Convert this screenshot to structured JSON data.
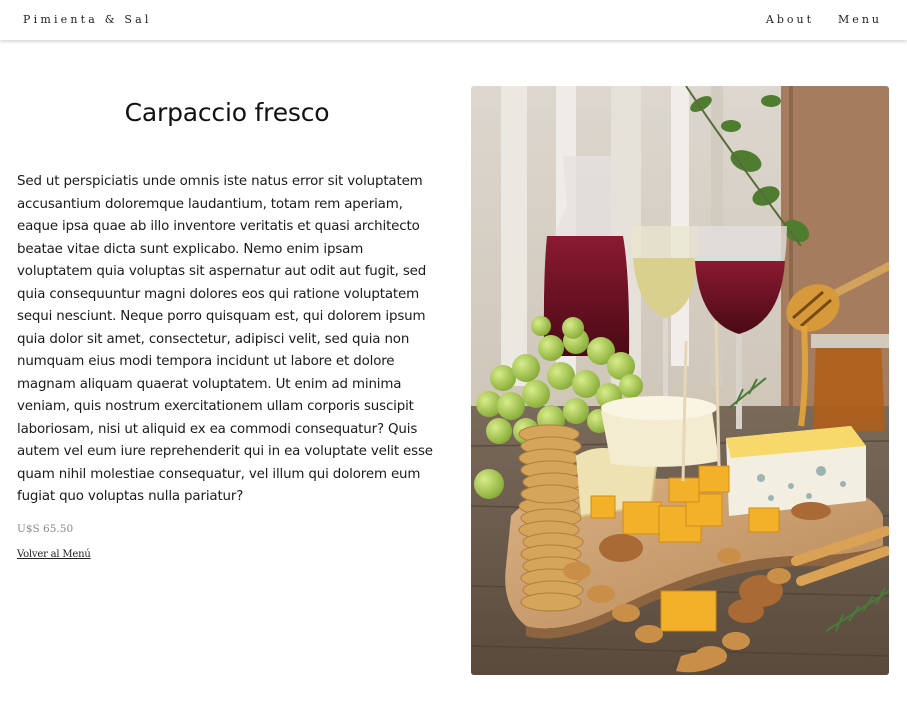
{
  "nav": {
    "brand": "Pimienta & Sal",
    "links": [
      {
        "label": "About"
      },
      {
        "label": "Menu"
      }
    ]
  },
  "dish": {
    "title": "Carpaccio fresco",
    "description": "Sed ut perspiciatis unde omnis iste natus error sit voluptatem accusantium doloremque laudantium, totam rem aperiam, eaque ipsa quae ab illo inventore veritatis et quasi architecto beatae vitae dicta sunt explicabo. Nemo enim ipsam voluptatem quia voluptas sit aspernatur aut odit aut fugit, sed quia consequuntur magni dolores eos qui ratione voluptatem sequi nesciunt. Neque porro quisquam est, qui dolorem ipsum quia dolor sit amet, consectetur, adipisci velit, sed quia non numquam eius modi tempora incidunt ut labore et dolore magnam aliquam quaerat voluptatem. Ut enim ad minima veniam, quis nostrum exercitationem ullam corporis suscipit laboriosam, nisi ut aliquid ex ea commodi consequatur? Quis autem vel eum iure reprehenderit qui in ea voluptate velit esse quam nihil molestiae consequatur, vel illum qui dolorem eum fugiat quo voluptas nulla pariatur?",
    "price": "U$S 65.50",
    "back_link": "Volver al Menú"
  },
  "colors": {
    "text": "#1a1a1a",
    "muted": "#888888",
    "wood": "#6b5a4a",
    "board": "#c79a68",
    "cheese": "#f3b12a",
    "grapes": "#9cc04a",
    "wine": "#6e0f22"
  }
}
